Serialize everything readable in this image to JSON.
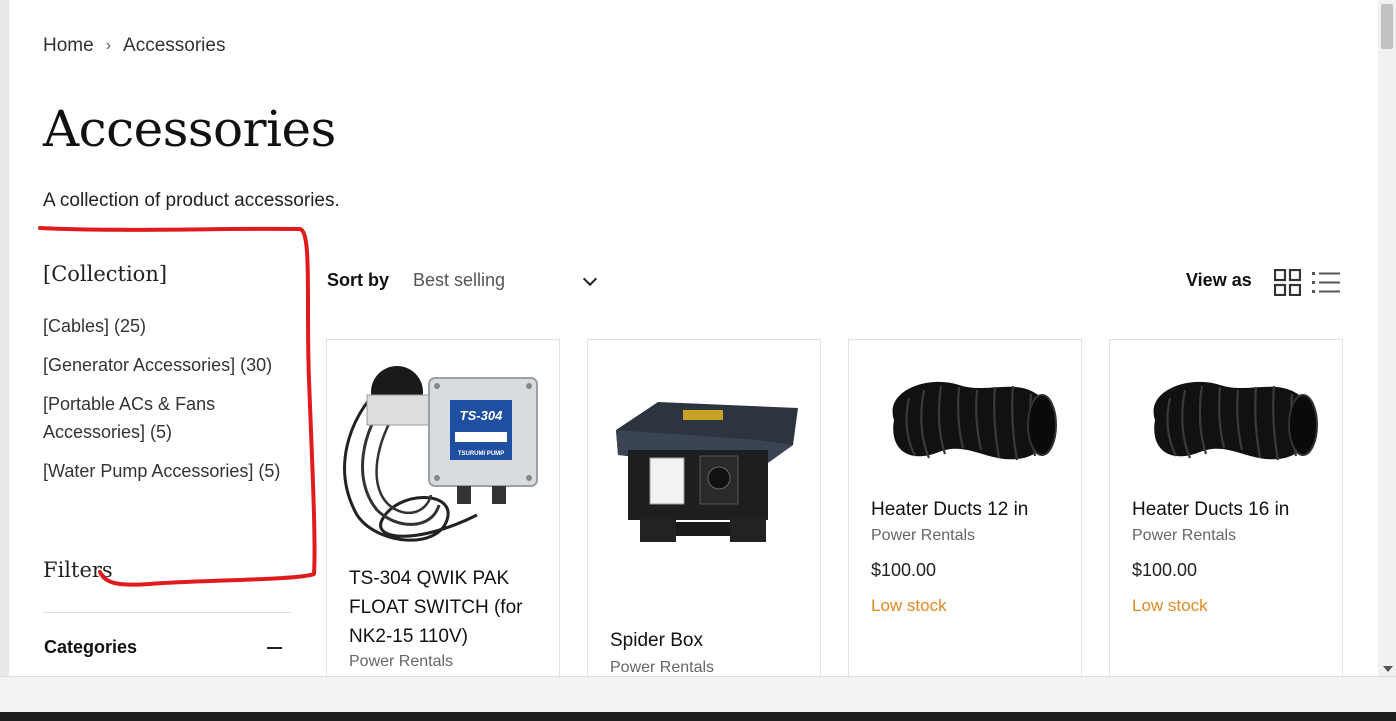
{
  "breadcrumb": {
    "home": "Home",
    "separator": "›",
    "current": "Accessories"
  },
  "page": {
    "title": "Accessories",
    "description": "A collection of product accessories."
  },
  "sidebar": {
    "collection_heading": "[Collection]",
    "collections": [
      {
        "label": "[Cables] (25)"
      },
      {
        "label": "[Generator Accessories] (30)"
      },
      {
        "label": "[Portable ACs & Fans Accessories] (5)"
      },
      {
        "label": "[Water Pump Accessories] (5)"
      }
    ],
    "filters_heading": "Filters",
    "categories_label": "Categories"
  },
  "toolbar": {
    "sort_label": "Sort by",
    "sort_value": "Best selling",
    "view_label": "View as"
  },
  "products": [
    {
      "name": "TS-304 QWIK PAK FLOAT SWITCH (for NK2-15 110V)",
      "vendor": "Power Rentals",
      "price": "",
      "stock": ""
    },
    {
      "name": "Spider Box",
      "vendor": "Power Rentals",
      "price": "",
      "stock": ""
    },
    {
      "name": "Heater Ducts 12 in",
      "vendor": "Power Rentals",
      "price": "$100.00",
      "stock": "Low stock"
    },
    {
      "name": "Heater Ducts 16 in",
      "vendor": "Power Rentals",
      "price": "$100.00",
      "stock": "Low stock"
    }
  ],
  "product_image_text": {
    "ts304_badge": "TS-304",
    "ts304_brand": "TSURUMI PUMP"
  },
  "colors": {
    "stock_warning": "#e08a24",
    "annotation": "#e01b1b"
  },
  "icons": [
    "chevron-right-icon",
    "chevron-down-icon",
    "grid-view-icon",
    "list-view-icon",
    "minus-icon"
  ]
}
